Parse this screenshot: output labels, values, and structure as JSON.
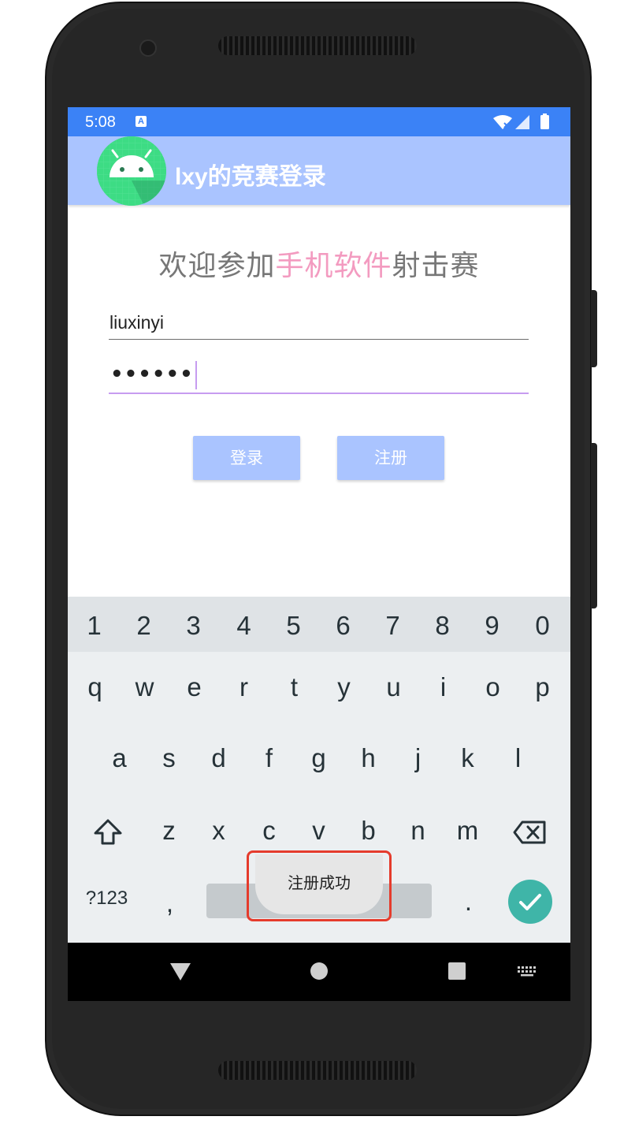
{
  "status_bar": {
    "time": "5:08",
    "notification_icon": "A"
  },
  "app_bar": {
    "title": "lxy的竞赛登录",
    "logo_icon": "android-icon"
  },
  "welcome": {
    "prefix": "欢迎参加",
    "highlight": "手机软件",
    "suffix": "射击赛"
  },
  "form": {
    "username_value": "liuxinyi",
    "password_mask": "••••••"
  },
  "buttons": {
    "login": "登录",
    "register": "注册"
  },
  "keyboard": {
    "numbers": [
      "1",
      "2",
      "3",
      "4",
      "5",
      "6",
      "7",
      "8",
      "9",
      "0"
    ],
    "row1": [
      "q",
      "w",
      "e",
      "r",
      "t",
      "y",
      "u",
      "i",
      "o",
      "p"
    ],
    "row2": [
      "a",
      "s",
      "d",
      "f",
      "g",
      "h",
      "j",
      "k",
      "l"
    ],
    "row3": [
      "z",
      "x",
      "c",
      "v",
      "b",
      "n",
      "m"
    ],
    "symbols_key": "?123",
    "comma": ",",
    "period": "."
  },
  "toast": {
    "message": "注册成功"
  },
  "colors": {
    "status_bar": "#3b82f6",
    "app_bar": "#aac4ff",
    "accent_text": "#f39bc0",
    "focus_underline": "#c79cf0",
    "enter_key": "#3fb5a8",
    "highlight_box": "#e53b2c"
  }
}
